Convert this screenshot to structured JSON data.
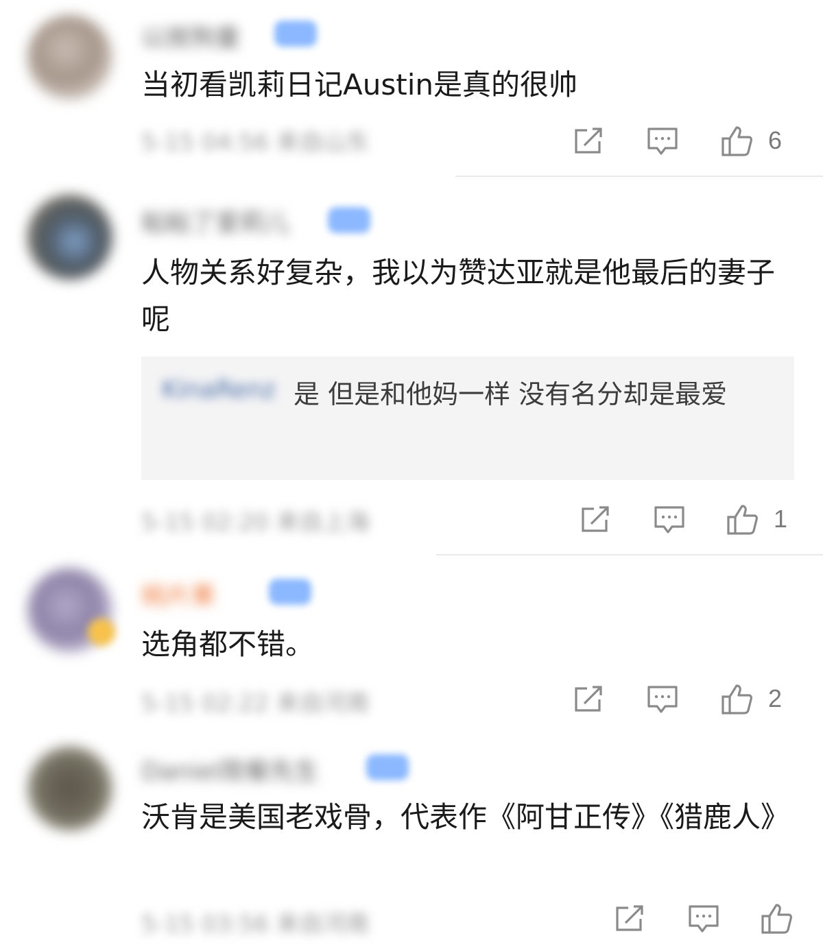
{
  "comments": [
    {
      "username": "以按狗童",
      "text": "当初看凯莉日记Austin是真的很帅",
      "meta": "5-15 04:56 来自山东",
      "likes": "6"
    },
    {
      "username": "粘粘了爱莉儿",
      "text": "人物关系好复杂，我以为赞达亚就是他最后的妻子呢",
      "reply": {
        "username": "KinaRenz",
        "text": "是 但是和他妈一样 没有名分却是最爱"
      },
      "meta": "5-15 02:20 来自上海",
      "likes": "1"
    },
    {
      "username": "桃片果",
      "text": "选角都不错。",
      "meta": "5-15 02:22 来自河南",
      "likes": "2"
    },
    {
      "username": "Daniel简餐先生",
      "text": "沃肯是美国老戏骨，代表作《阿甘正传》《猎鹿人》",
      "meta": "5-15 03:56 来自河南",
      "likes": ""
    }
  ],
  "icons": {
    "share": "share-icon",
    "comment": "comment-icon",
    "like": "thumbs-up-icon"
  },
  "colors": {
    "text": "#1a1a1a",
    "icon": "#8a8a8a",
    "reply_bg": "#f4f4f5",
    "vip_badge": "#8bb8ff"
  }
}
